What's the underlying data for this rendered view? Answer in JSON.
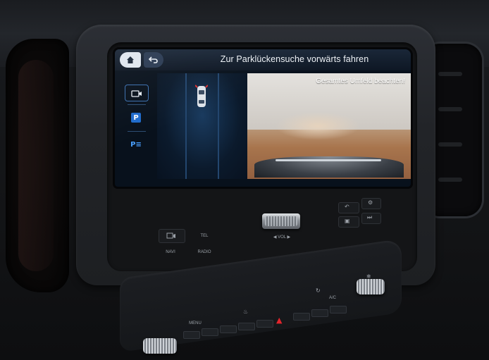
{
  "display": {
    "title": "Zur Parklückensuche vorwärts fahren",
    "camera_note": "Gesamtes Umfeld beachten!",
    "side_menu": {
      "p_label": "P",
      "park_assist_label": "P≡"
    }
  },
  "controls": {
    "tel_label": "TEL",
    "vol_label": "◀  VOL  ▶",
    "nav_label": "NAVI",
    "radio_label": "RADIO"
  },
  "climate": {
    "menu_label": "MENU",
    "ac_label": "A/C"
  },
  "colors": {
    "display_bg": "#08111c",
    "accent_blue": "#1f6bcc",
    "hazard_red": "#e3252c"
  }
}
